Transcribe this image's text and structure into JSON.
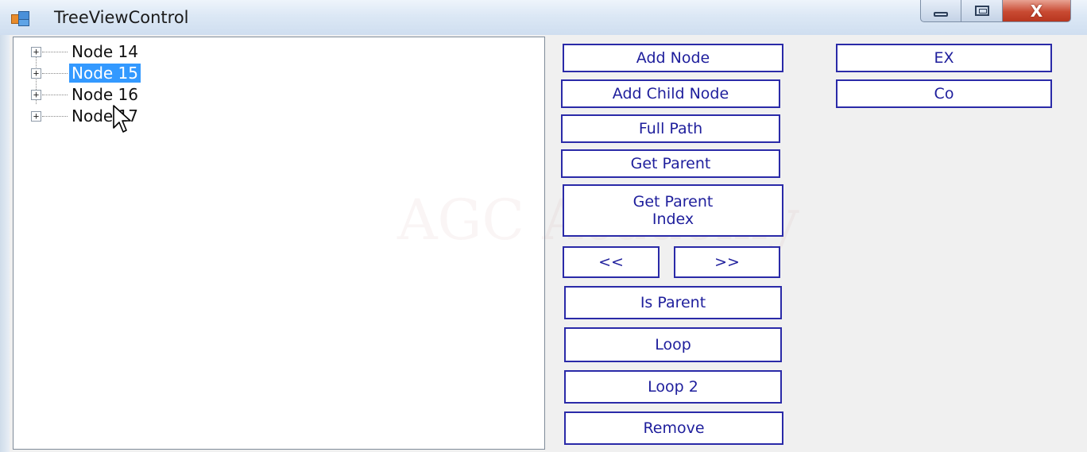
{
  "window": {
    "title": "TreeViewControl",
    "close_glyph": "X"
  },
  "tree": {
    "nodes": [
      {
        "label": "Node 14",
        "expander": "+"
      },
      {
        "label": "Node 15",
        "expander": "+",
        "selected": true
      },
      {
        "label": "Node 16",
        "expander": "+"
      },
      {
        "label": "Node 17",
        "expander": "+"
      }
    ]
  },
  "buttons": {
    "add_node": "Add Node",
    "add_child_node": "Add Child Node",
    "full_path": "Full Path",
    "get_parent": "Get Parent",
    "get_parent_index": "Get Parent Index",
    "prev": "<<",
    "next": ">>",
    "is_parent": "Is Parent",
    "loop": "Loop",
    "loop2": "Loop 2",
    "remove": "Remove",
    "ex": "EX",
    "co": "Co"
  },
  "watermark": "AGC Academy",
  "colors": {
    "selection": "#3399ff",
    "button_border": "#2a2aa8",
    "button_text": "#1e1e9c"
  },
  "icons": {
    "app": "app-window-icon",
    "minimize": "minimize-icon",
    "maximize": "maximize-icon",
    "close": "close-icon",
    "cursor": "mouse-pointer-icon"
  }
}
